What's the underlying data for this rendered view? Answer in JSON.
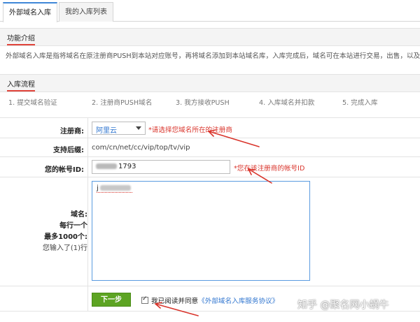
{
  "tabs": [
    {
      "label": "外部域名入库",
      "active": true
    },
    {
      "label": "我的入库列表",
      "active": false
    }
  ],
  "intro": {
    "title": "功能介绍",
    "text": "外部域名入库是指将域名在原注册商PUSH到本站对应账号，再将域名添加到本站域名库，入库完成后，域名可在本站进行交易，出售，以及管理。"
  },
  "process": {
    "title": "入库流程",
    "steps": [
      "1. 提交域名验证",
      "2. 注册商PUSH域名",
      "3. 我方接收PUSH",
      "4. 入库域名并扣款",
      "5. 完成入库"
    ]
  },
  "form": {
    "registrar_label": "注册商:",
    "registrar_value": "阿里云",
    "registrar_hint": "*请选择您域名所在的注册商",
    "suffix_label": "支持后缀:",
    "suffix_value": "com/cn/net/cc/vip/top/tv/vip",
    "account_label": "您的帐号ID:",
    "account_value_visible": "1793",
    "account_hint": "*您在该注册商的帐号ID",
    "domain_label_1": "域名:",
    "domain_label_2": "每行一个",
    "domain_label_3": "最多1000个:",
    "domain_count": "您输入了(1)行",
    "domain_entry_prefix": "j",
    "next_button": "下一步",
    "agree_text": "我已阅读并同意",
    "agree_link": "《外部域名入库服务协议》"
  },
  "colors": {
    "accent_blue": "#3f87d8",
    "hint_red": "#d9342b",
    "button_green": "#5da423",
    "annotation_arrow": "#d9342b"
  },
  "watermark": "知乎 @聚名网小蜗牛"
}
